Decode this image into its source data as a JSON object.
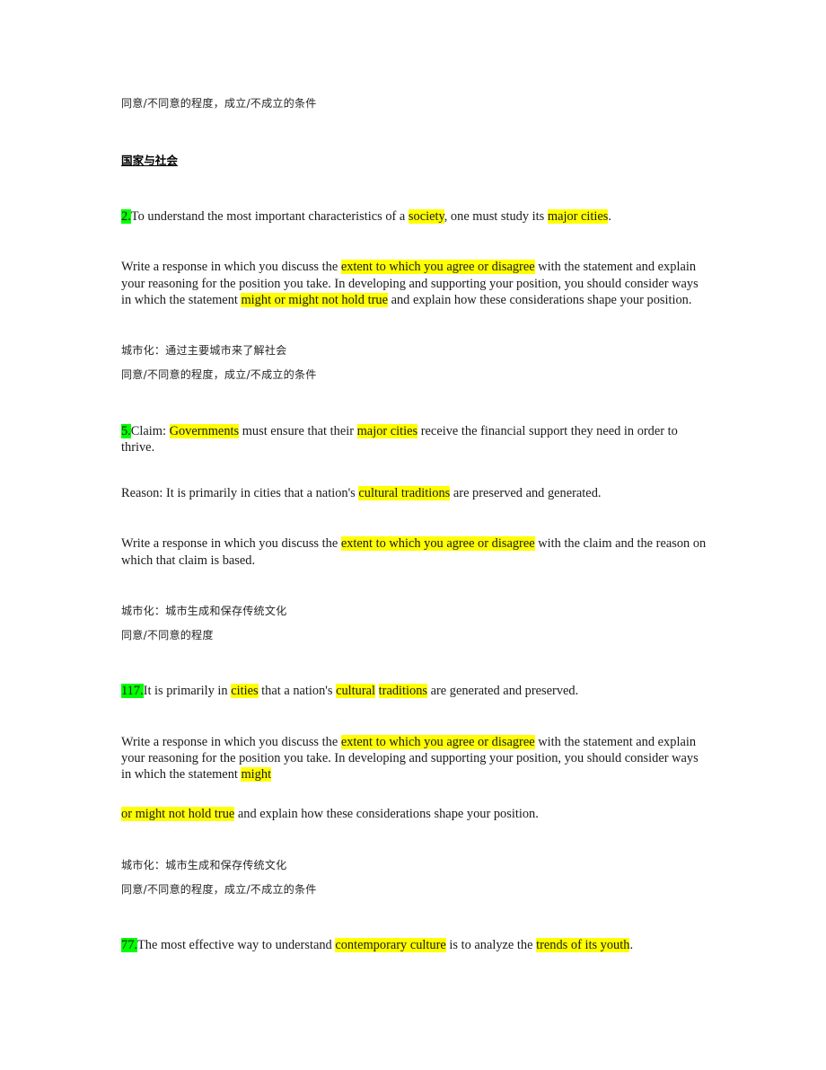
{
  "document": {
    "colors": {
      "highlight_yellow": "#ffff00",
      "highlight_green": "#00ff00",
      "text": "#1a1a1a",
      "page_background": "#ffffff"
    },
    "section_heading": "国家与社会",
    "top_note": "同意/不同意的程度，成立/不成立的条件",
    "blocks": {
      "topic2": {
        "number": "2.",
        "s1": "To understand the most important characteristics of a ",
        "hl1": "society",
        "s2": ", one must study its ",
        "hl2": "major cities",
        "s3": "."
      },
      "instr_a": {
        "s1": "Write a response in which you discuss the ",
        "hl1": "extent to which you agree or disagree",
        "s2": " with the statement and explain your reasoning for the position you take. In developing and supporting your position, you should consider ways in which the statement ",
        "hl2": "might or might not hold true",
        "s3": " and explain how these considerations shape your position."
      },
      "note2": {
        "line1": "城市化：通过主要城市来了解社会",
        "line2": "同意/不同意的程度，成立/不成立的条件"
      },
      "topic5": {
        "number": "5.",
        "s1": "Claim: ",
        "hl1": "Governments",
        "s2": " must ensure that their ",
        "hl2": "major cities",
        "s3": " receive the financial support they need in order to thrive."
      },
      "reason5": {
        "s1": "Reason: It is primarily in cities that a nation's ",
        "hl1": "cultural traditions",
        "s2": " are preserved and generated."
      },
      "instr_b": {
        "s1": "Write a response in which you discuss the ",
        "hl1": "extent to which you agree or disagree",
        "s2": " with the claim and the reason on which that claim is based."
      },
      "note5": {
        "line1": "城市化：城市生成和保存传统文化",
        "line2": "同意/不同意的程度"
      },
      "topic117": {
        "number": "117.",
        "s1": "It is primarily in ",
        "hl1": "cities",
        "s2": " that a nation's ",
        "hl2": "cultural",
        "s3": " ",
        "hl3": "traditions",
        "s4": " are generated and preserved."
      },
      "instr_c": {
        "s1": "Write a response in which you discuss the ",
        "hl1": "extent to which you agree or disagree",
        "s2": " with the statement and explain your reasoning for the position you take. In developing and supporting your position, you should consider ways in which the statement ",
        "hl2": "might",
        "s3": "",
        "hl3": "or might not hold true",
        "s4": " and explain how these considerations shape your position."
      },
      "note117": {
        "line1": "城市化：城市生成和保存传统文化",
        "line2": "同意/不同意的程度，成立/不成立的条件"
      },
      "topic77": {
        "number": "77.",
        "s1": "The most effective way to understand ",
        "hl1": "contemporary culture",
        "s2": " is to analyze the ",
        "hl2": "trends of its youth",
        "s3": "."
      }
    }
  }
}
